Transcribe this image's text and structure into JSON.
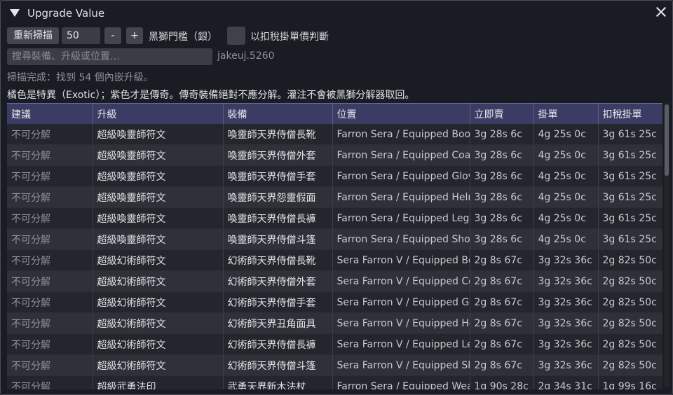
{
  "window": {
    "title": "Upgrade Value"
  },
  "toolbar": {
    "rescan_label": "重新掃描",
    "threshold_value": "50",
    "minus_label": "-",
    "plus_label": "+",
    "threshold_label": "黑獅門檻（銀）",
    "tax_checkbox_label": "以扣稅掛單價判斷",
    "tax_checked": false
  },
  "search": {
    "placeholder": "搜尋裝備、升級或位置…"
  },
  "account": "jakeuj.5260",
  "status": "掃描完成：找到 54 個內嵌升級。",
  "note": "橘色是特異（Exotic）；紫色才是傳奇。傳奇裝備絕對不應分解。灌注不會被黑獅分解器取回。",
  "table": {
    "columns": [
      "建議",
      "升級",
      "裝備",
      "位置",
      "立即賣",
      "掛單",
      "扣稅掛單"
    ],
    "rows": [
      [
        "不可分解",
        "超級喚靈師符文",
        "喚靈師天界侍僧長靴",
        "Farron Sera / Equipped Boots",
        "3g 28s 6c",
        "4g 25s 0c",
        "3g 61s 25c"
      ],
      [
        "不可分解",
        "超級喚靈師符文",
        "喚靈師天界侍僧外套",
        "Farron Sera / Equipped Coat",
        "3g 28s 6c",
        "4g 25s 0c",
        "3g 61s 25c"
      ],
      [
        "不可分解",
        "超級喚靈師符文",
        "喚靈師天界侍僧手套",
        "Farron Sera / Equipped Gloves",
        "3g 28s 6c",
        "4g 25s 0c",
        "3g 61s 25c"
      ],
      [
        "不可分解",
        "超級喚靈師符文",
        "喚靈師天界怨靈假面",
        "Farron Sera / Equipped Helm",
        "3g 28s 6c",
        "4g 25s 0c",
        "3g 61s 25c"
      ],
      [
        "不可分解",
        "超級喚靈師符文",
        "喚靈師天界侍僧長褲",
        "Farron Sera / Equipped Leggings",
        "3g 28s 6c",
        "4g 25s 0c",
        "3g 61s 25c"
      ],
      [
        "不可分解",
        "超級喚靈師符文",
        "喚靈師天界侍僧斗篷",
        "Farron Sera / Equipped Shoulders",
        "3g 28s 6c",
        "4g 25s 0c",
        "3g 61s 25c"
      ],
      [
        "不可分解",
        "超級幻術師符文",
        "幻術師天界侍僧長靴",
        "Sera Farron V / Equipped Boots",
        "2g 8s 67c",
        "3g 32s 36c",
        "2g 82s 50c"
      ],
      [
        "不可分解",
        "超級幻術師符文",
        "幻術師天界侍僧外套",
        "Sera Farron V / Equipped Coat",
        "2g 8s 67c",
        "3g 32s 36c",
        "2g 82s 50c"
      ],
      [
        "不可分解",
        "超級幻術師符文",
        "幻術師天界侍僧手套",
        "Sera Farron V / Equipped Gloves",
        "2g 8s 67c",
        "3g 32s 36c",
        "2g 82s 50c"
      ],
      [
        "不可分解",
        "超級幻術師符文",
        "幻術師天界丑角面具",
        "Sera Farron V / Equipped Helm",
        "2g 8s 67c",
        "3g 32s 36c",
        "2g 82s 50c"
      ],
      [
        "不可分解",
        "超級幻術師符文",
        "幻術師天界侍僧長褲",
        "Sera Farron V / Equipped Leggings",
        "2g 8s 67c",
        "3g 32s 36c",
        "2g 82s 50c"
      ],
      [
        "不可分解",
        "超級幻術師符文",
        "幻術師天界侍僧斗篷",
        "Sera Farron V / Equipped Shoulders",
        "2g 8s 67c",
        "3g 32s 36c",
        "2g 82s 50c"
      ],
      [
        "不可分解",
        "超級武勇法印",
        "武勇天界新木法杖",
        "Farron Sera / Equipped Weapon",
        "1g 90s 28c",
        "2g 34s 31c",
        "1g 99s 16c"
      ]
    ]
  }
}
